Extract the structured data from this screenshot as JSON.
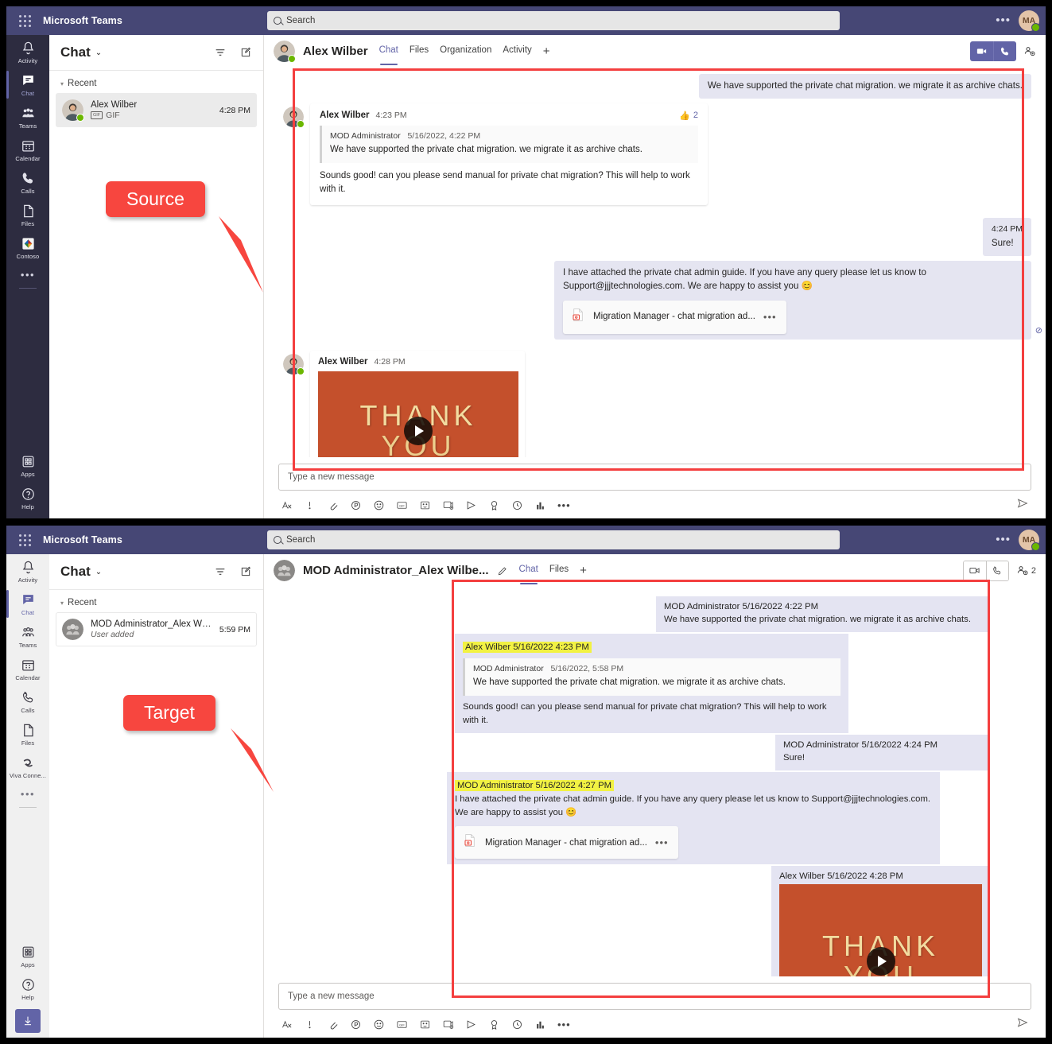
{
  "app": {
    "title": "Microsoft Teams",
    "search_placeholder": "Search",
    "avatar_initials": "MA",
    "more_dots": "•••"
  },
  "annotations": {
    "source_label": "Source",
    "target_label": "Target",
    "highlight_color": "#f43f3f",
    "callout_color": "#f7463f"
  },
  "source": {
    "rail": [
      {
        "label": "Activity",
        "icon": "bell-icon",
        "active": false
      },
      {
        "label": "Chat",
        "icon": "chat-icon",
        "active": true
      },
      {
        "label": "Teams",
        "icon": "teams-icon",
        "active": false
      },
      {
        "label": "Calendar",
        "icon": "calendar-icon",
        "active": false
      },
      {
        "label": "Calls",
        "icon": "phone-icon",
        "active": false
      },
      {
        "label": "Files",
        "icon": "file-icon",
        "active": false
      },
      {
        "label": "Contoso",
        "icon": "contoso-icon",
        "active": false
      }
    ],
    "rail_bottom": [
      {
        "label": "Apps",
        "icon": "apps-icon"
      },
      {
        "label": "Help",
        "icon": "help-icon"
      }
    ],
    "chat_list": {
      "title": "Chat",
      "filter_icon": "filter-icon",
      "compose_icon": "compose-icon",
      "section": "Recent",
      "items": [
        {
          "name": "Alex Wilber",
          "subtitle": "GIF",
          "sub_badge": "GIF",
          "time": "4:28 PM"
        }
      ]
    },
    "header": {
      "name": "Alex Wilber",
      "tabs": [
        {
          "label": "Chat",
          "active": true
        },
        {
          "label": "Files",
          "active": false
        },
        {
          "label": "Organization",
          "active": false
        },
        {
          "label": "Activity",
          "active": false
        }
      ],
      "add_tab": "+",
      "video_icon": "video-call-icon",
      "audio_icon": "audio-call-icon",
      "people_icon": "add-people-icon"
    },
    "messages": {
      "m1": {
        "text": "We have supported the private chat migration. we migrate it as archive chats."
      },
      "m2": {
        "author": "Alex Wilber",
        "time": "4:23 PM",
        "reaction_icon": "thumbs-up-icon",
        "reaction_count": "2",
        "quote_author": "MOD Administrator",
        "quote_time": "5/16/2022, 4:22 PM",
        "quote_text": "We have supported the private chat migration. we migrate it as archive chats.",
        "reply": "Sounds good! can you please send manual for private chat migration? This will help to work with it."
      },
      "m3": {
        "time": "4:24 PM",
        "text": "Sure!"
      },
      "m4": {
        "text": "I have attached the private chat admin guide. If you have any query please let us know to Support@jjjtechnologies.com. We are happy to assist you 😊",
        "attachment": "Migration Manager - chat migration ad...",
        "attachment_dots": "•••",
        "attachment_icon": "pdf-file-icon",
        "status_icon": "sent-check-icon"
      },
      "m5": {
        "author": "Alex Wilber",
        "time": "4:28 PM",
        "gif_line1": "THANK",
        "gif_line2": "YOU",
        "play_icon": "play-icon"
      }
    },
    "composer": {
      "placeholder": "Type a new message",
      "tools": [
        {
          "icon": "format-icon"
        },
        {
          "icon": "priority-icon"
        },
        {
          "icon": "attach-icon"
        },
        {
          "icon": "loop-icon"
        },
        {
          "icon": "emoji-icon"
        },
        {
          "icon": "gif-icon"
        },
        {
          "icon": "sticker-icon"
        },
        {
          "icon": "meet-now-icon"
        },
        {
          "icon": "stream-icon"
        },
        {
          "icon": "praise-icon"
        },
        {
          "icon": "approvals-icon"
        },
        {
          "icon": "poll-icon"
        }
      ],
      "more_dots": "•••",
      "send_icon": "send-icon"
    }
  },
  "target": {
    "rail": [
      {
        "label": "Activity",
        "icon": "bell-icon",
        "active": false
      },
      {
        "label": "Chat",
        "icon": "chat-icon",
        "active": true
      },
      {
        "label": "Teams",
        "icon": "teams-icon",
        "active": false
      },
      {
        "label": "Calendar",
        "icon": "calendar-icon",
        "active": false
      },
      {
        "label": "Calls",
        "icon": "phone-icon",
        "active": false
      },
      {
        "label": "Files",
        "icon": "file-icon",
        "active": false
      },
      {
        "label": "Viva Conne...",
        "icon": "viva-connections-icon",
        "active": false
      }
    ],
    "rail_bottom": [
      {
        "label": "Apps",
        "icon": "apps-icon"
      },
      {
        "label": "Help",
        "icon": "help-icon"
      }
    ],
    "download_icon": "download-icon",
    "chat_list": {
      "title": "Chat",
      "filter_icon": "filter-icon",
      "compose_icon": "compose-icon",
      "section": "Recent",
      "items": [
        {
          "name": "MOD Administrator_Alex Wilber_Ar...",
          "subtitle": "User added",
          "time": "5:59 PM"
        }
      ]
    },
    "header": {
      "name": "MOD Administrator_Alex Wilbe...",
      "edit_icon": "pencil-icon",
      "tabs": [
        {
          "label": "Chat",
          "active": true
        },
        {
          "label": "Files",
          "active": false
        }
      ],
      "add_tab": "+",
      "video_icon": "video-call-icon",
      "audio_icon": "audio-call-icon",
      "people_icon": "add-people-icon",
      "people_count": "2"
    },
    "messages": {
      "m1": {
        "head": "MOD Administrator 5/16/2022 4:22 PM",
        "text": "We have supported the private chat migration. we migrate it as archive chats."
      },
      "m2": {
        "head": "Alex Wilber 5/16/2022 4:23 PM",
        "highlight": true,
        "quote_author": "MOD Administrator",
        "quote_time": "5/16/2022, 5:58 PM",
        "quote_text": "We have supported the private chat migration. we migrate it as archive chats.",
        "reply": "Sounds good! can you please send manual for private chat migration? This will help to work with it."
      },
      "m3": {
        "head": "MOD Administrator 5/16/2022 4:24 PM",
        "text": "Sure!"
      },
      "m4": {
        "head": "MOD Administrator 5/16/2022 4:27 PM",
        "highlight": true,
        "text": "I have attached the private chat admin guide. If you have any query please let us know to Support@jjjtechnologies.com. We are happy to assist you 😊",
        "attachment": "Migration Manager - chat migration ad...",
        "attachment_dots": "•••",
        "attachment_icon": "pdf-file-icon"
      },
      "m5": {
        "head": "Alex Wilber 5/16/2022 4:28 PM",
        "gif_line1": "THANK",
        "gif_line2": "YOU",
        "play_icon": "play-icon"
      }
    },
    "composer": {
      "placeholder": "Type a new message",
      "more_dots": "•••",
      "send_icon": "send-icon"
    }
  }
}
